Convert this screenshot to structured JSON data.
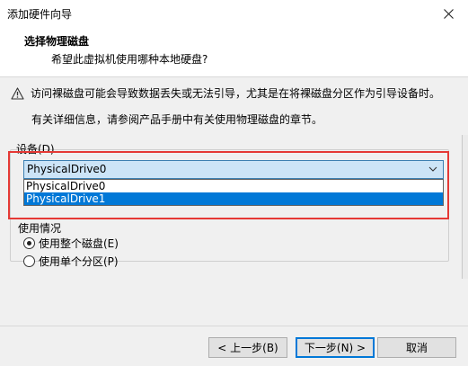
{
  "window": {
    "title": "添加硬件向导",
    "close_icon": "close-icon"
  },
  "header": {
    "title": "选择物理磁盘",
    "subtitle": "希望此虚拟机使用哪种本地硬盘?"
  },
  "warning": {
    "icon": "warning-icon",
    "text": "访问裸磁盘可能会导致数据丢失或无法引导，尤其是在将裸磁盘分区作为引导设备时。"
  },
  "info": "有关详细信息，请参阅产品手册中有关使用物理磁盘的章节。",
  "device": {
    "label": "设备(D)",
    "selected": "PhysicalDrive0",
    "options": [
      "PhysicalDrive0",
      "PhysicalDrive1"
    ],
    "highlighted_index": 1
  },
  "usage": {
    "label": "使用情况",
    "options": [
      {
        "label": "使用整个磁盘(E)",
        "checked": true
      },
      {
        "label": "使用单个分区(P)",
        "checked": false
      }
    ]
  },
  "buttons": {
    "back": "< 上一步(B)",
    "next": "下一步(N) >",
    "cancel": "取消"
  },
  "colors": {
    "selection": "#0078d7",
    "combo_focus": "#cce4f7",
    "annotation": "#e53935"
  }
}
